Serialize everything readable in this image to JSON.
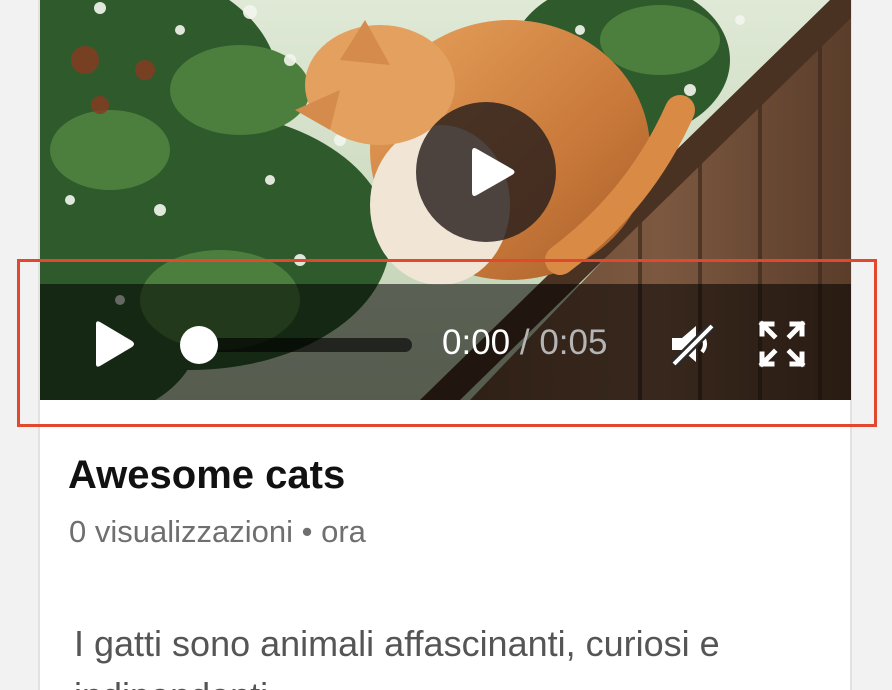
{
  "video": {
    "big_play_icon": "play-icon",
    "controls": {
      "play_icon": "play-icon",
      "current_time": "0:00",
      "separator": " / ",
      "duration": "0:05",
      "progress": 0.0,
      "mute_icon": "volume-muted-icon",
      "fullscreen_icon": "fullscreen-icon"
    }
  },
  "post": {
    "title": "Awesome cats",
    "meta": "0 visualizzazioni • ora",
    "description": "I gatti sono animali affascinanti, curiosi e indipendenti."
  },
  "colors": {
    "highlight": "#e2482d",
    "control_bar": "rgba(0,0,0,0.55)",
    "title": "#111111",
    "meta": "#6f6f6f"
  }
}
